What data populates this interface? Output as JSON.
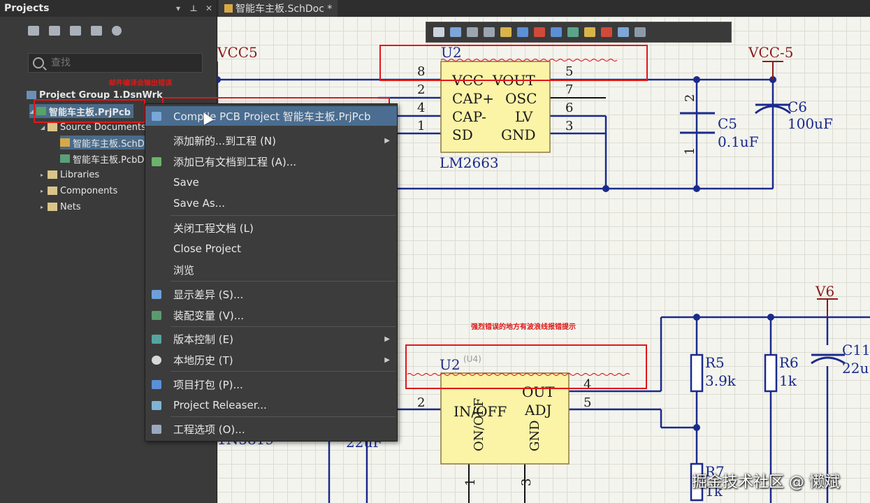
{
  "panel": {
    "title": "Projects",
    "search_placeholder": "查找",
    "tree": [
      {
        "label": "Project Group 1.DsnWrk"
      },
      {
        "label": "智能车主板.PrjPcb"
      },
      {
        "label": "Source Documents"
      },
      {
        "label": "智能车主板.SchDoc"
      },
      {
        "label": "智能车主板.PcbDoc"
      },
      {
        "label": "Libraries"
      },
      {
        "label": "Components"
      },
      {
        "label": "Nets"
      }
    ]
  },
  "doc_tab": {
    "label": "智能车主板.SchDoc *"
  },
  "context_menu": [
    {
      "label": "Compile PCB Project 智能车主板.PrjPcb",
      "icon_color": "#7aa8d6"
    },
    {
      "label": "添加新的...到工程 (N)",
      "icon_color": ""
    },
    {
      "label": "添加已有文档到工程 (A)...",
      "icon_color": "#6bb36b"
    },
    {
      "label": "Save",
      "icon_color": ""
    },
    {
      "label": "Save As...",
      "icon_color": ""
    },
    {
      "label": "关闭工程文档 (L)",
      "icon_color": ""
    },
    {
      "label": "Close Project",
      "icon_color": ""
    },
    {
      "label": "浏览",
      "icon_color": ""
    },
    {
      "label": "显示差异 (S)...",
      "icon_color": "#6f9fd8"
    },
    {
      "label": "装配变量 (V)...",
      "icon_color": "#5a9a6e"
    },
    {
      "label": "版本控制 (E)",
      "icon_color": "#56a3a0"
    },
    {
      "label": "本地历史 (T)",
      "icon_color": "#d8d8d8"
    },
    {
      "label": "项目打包 (P)...",
      "icon_color": "#5b8fd8"
    },
    {
      "label": "Project Releaser...",
      "icon_color": "#7fb3d8"
    },
    {
      "label": "工程选项 (O)...",
      "icon_color": "#9aa8c0"
    }
  ],
  "annotations": {
    "compile_note": "邮件编译会输出错误",
    "error_note": "强烈错误的地方有波浪线报错提示"
  },
  "schematic": {
    "labels": {
      "vcc5_left": "VCC5",
      "vcc_5_right": "VCC-5",
      "u2_top": "U2",
      "u2_bottom": "U2",
      "u4": "(U4)",
      "lm2663": "LM2663",
      "vcc": "VCC",
      "vout": "VOUT",
      "capp": "CAP+",
      "osc": "OSC",
      "capm": "CAP-",
      "lv": "LV",
      "sd": "SD",
      "gnd": "GND",
      "c5": "C5",
      "c5v": "0.1uF",
      "c6": "C6",
      "c6v": "100uF",
      "v6": "V6",
      "r5": "R5",
      "r5v": "3.9k",
      "r6": "R6",
      "r6v": "1k",
      "c11": "C11",
      "c11v": "22u",
      "out": "OUT",
      "adj": "ADJ",
      "in_off": "IN/OFF",
      "on_off": "ON/OFF",
      "gnd2": "GND",
      "r7v": "1k",
      "r7": "R7",
      "p8": "8",
      "p5": "5",
      "p2": "2",
      "p7": "7",
      "p4": "4",
      "p6": "6",
      "p1": "1",
      "p3": "3",
      "q2": "2",
      "q4": "4",
      "q5": "5",
      "q1": "1",
      "q3": "3",
      "c5p2": "2",
      "c5p1": "1",
      "n5819": "1N5819",
      "c22": "22uF"
    }
  },
  "watermark": "掘金技术社区 @ 懒斌",
  "colors": {
    "wire": "#1a2a8c",
    "chip": "#fbf3a6",
    "power": "#8b1a1a",
    "highlight": "#4a6d91",
    "annot_red": "#e01818"
  }
}
